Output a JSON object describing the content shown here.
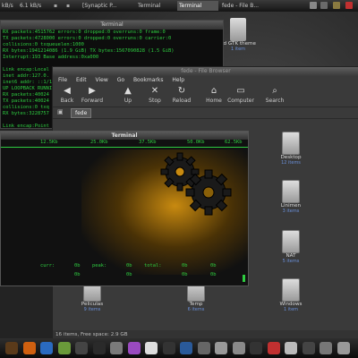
{
  "taskbar": {
    "net_rate": "kB/s",
    "net_rate2": "6.1 kB/s",
    "items": [
      "[Synaptic P...",
      "Terminal",
      "Terminal",
      "fede - File B..."
    ]
  },
  "terminal1": {
    "title": "Terminal",
    "lines": [
      "RX packets:4515762 errors:0 dropped:0 overruns:0 frame:0",
      "TX packets:4728000 errors:0 dropped:0 overruns:0 carrier:0",
      "collisions:0 txqueuelen:1000",
      "RX bytes:1941214086 (1.9 GiB)  TX bytes:1567090828 (1.5 GiB)",
      "Interrupt:193 Base address:0xa000",
      "",
      "Link encap:Local",
      "inet addr:127.0.",
      "inet6 addr: ::1/1",
      "UP LOOPBACK RUNNI",
      "RX packets:40024",
      "TX packets:40024",
      "collisions:0 txq",
      "RX bytes:3228757",
      "",
      "Link encap:Point"
    ]
  },
  "gtk_icon": {
    "label": "ed GTK theme",
    "sub": "1 item"
  },
  "file_browser": {
    "title": "fede - File Browser",
    "menu": [
      "File",
      "Edit",
      "View",
      "Go",
      "Bookmarks",
      "Help"
    ],
    "toolbar": [
      {
        "label": "Back",
        "icon": "back-icon",
        "glyph": "◀"
      },
      {
        "label": "Forward",
        "icon": "forward-icon",
        "glyph": "▶"
      },
      {
        "label": "Up",
        "icon": "up-icon",
        "glyph": "▲"
      },
      {
        "label": "Stop",
        "icon": "stop-icon",
        "glyph": "✕"
      },
      {
        "label": "Reload",
        "icon": "reload-icon",
        "glyph": "↻"
      },
      {
        "label": "Home",
        "icon": "home-icon",
        "glyph": "⌂"
      },
      {
        "label": "Computer",
        "icon": "computer-icon",
        "glyph": "▭"
      },
      {
        "label": "Search",
        "icon": "search-icon",
        "glyph": "⌕"
      }
    ],
    "location": "fede",
    "folders": [
      {
        "name": "Desktop",
        "count": "12 items"
      },
      {
        "name": "Linimen",
        "count": "3 items"
      },
      {
        "name": "NAT",
        "count": "5 items"
      },
      {
        "name": "Windows",
        "count": "1 item"
      },
      {
        "name": "Peliculas",
        "count": "9 items"
      },
      {
        "name": "Temp",
        "count": "6 items"
      }
    ],
    "status": "16 items, Free space: 2.9 GB"
  },
  "terminal2": {
    "title": "Terminal",
    "ruler": [
      "12.5Kb",
      "25.0Kb",
      "37.5Kb",
      "50.0Kb",
      "62.5Kb"
    ],
    "stats": {
      "curr_label": "curr:",
      "curr_val": "0b",
      "peak_label": "peak:",
      "peak_val": "0b",
      "total_label": "total:",
      "total_val": "0b",
      "extra1": "0b",
      "extra2": "0b"
    }
  },
  "colors": {
    "terminal_green": "#2ecc40",
    "desktop": "#2a2a2a",
    "gear": "#f0a000"
  }
}
